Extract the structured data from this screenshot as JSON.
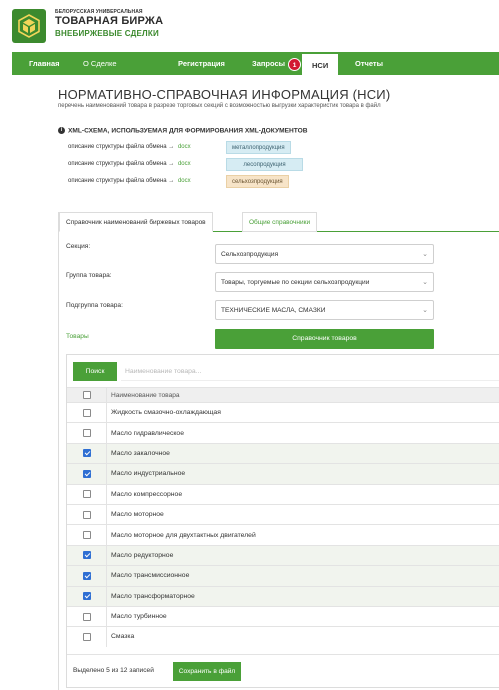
{
  "brand": {
    "top": "БЕЛОРУССКАЯ УНИВЕРСАЛЬНАЯ",
    "main": "ТОВАРНАЯ БИРЖА",
    "sub": "ВНЕБИРЖЕВЫЕ СДЕЛКИ",
    "colors": {
      "green": "#4aa038",
      "dark_green": "#3c8a2e",
      "badge_red": "#d21a32"
    }
  },
  "nav": {
    "items": [
      {
        "label": "Главная"
      },
      {
        "label": "О Сделке"
      },
      {
        "label": "Регистрация"
      },
      {
        "label": "Запросы",
        "badge": "1"
      },
      {
        "label": "НСИ",
        "active": true
      },
      {
        "label": "Отчеты"
      }
    ]
  },
  "page": {
    "title": "НОРМАТИВНО-СПРАВОЧНАЯ ИНФОРМАЦИЯ (НСИ)",
    "subtitle": "перечень наименований товара в разрезе торговых секций с возможностью выгрузки характеристик товара в файл",
    "xml_title": "XML-СХЕМА, ИСПОЛЬЗУЕМАЯ ДЛЯ ФОРМИРОВАНИЯ XML-ДОКУМЕНТОВ",
    "info_icon": "i",
    "xml_rows": [
      {
        "text": "описание структуры файла обмена →",
        "link": "docx",
        "tag": "металлопродукция"
      },
      {
        "text": "описание структуры файла обмена →",
        "link": "docx",
        "tag": "лесопродукция"
      },
      {
        "text": "описание структуры файла обмена →",
        "link": "docx",
        "tag": "сельхозпродукция"
      }
    ]
  },
  "tabs": {
    "active": "Справочник наименований биржевых товаров",
    "inactive": "Общие справочники"
  },
  "form": {
    "section_label": "Секция:",
    "section_value": "Сельхозпродукция",
    "group_label": "Группа товара:",
    "group_value": "Товары, торгуемые по секции сельхозпродукции",
    "subgroup_label": "Подгруппа товара:",
    "subgroup_value": "ТЕХНИЧЕСКИЕ МАСЛА, СМАЗКИ",
    "goods_label": "Товары",
    "ref_button": "Справочник товаров"
  },
  "table": {
    "search_button": "Поиск",
    "search_placeholder": "Наименование товара...",
    "header": "Наименование товара",
    "rows": [
      {
        "name": "Жидкость смазочно-охлаждающая",
        "checked": false
      },
      {
        "name": "Масло гидравлическое",
        "checked": false
      },
      {
        "name": "Масло закалочное",
        "checked": true
      },
      {
        "name": "Масло индустриальное",
        "checked": true
      },
      {
        "name": "Масло компрессорное",
        "checked": false
      },
      {
        "name": "Масло моторное",
        "checked": false
      },
      {
        "name": "Масло моторное для двухтактных двигателей",
        "checked": false
      },
      {
        "name": "Масло редукторное",
        "checked": true
      },
      {
        "name": "Масло трансмиссионное",
        "checked": true
      },
      {
        "name": "Масло трансформаторное",
        "checked": true
      },
      {
        "name": "Масло турбинное",
        "checked": false
      },
      {
        "name": "Смазка",
        "checked": false
      }
    ],
    "footer_text": "Выделено 5 из 12 записей",
    "save_button": "Сохранить в файл"
  }
}
